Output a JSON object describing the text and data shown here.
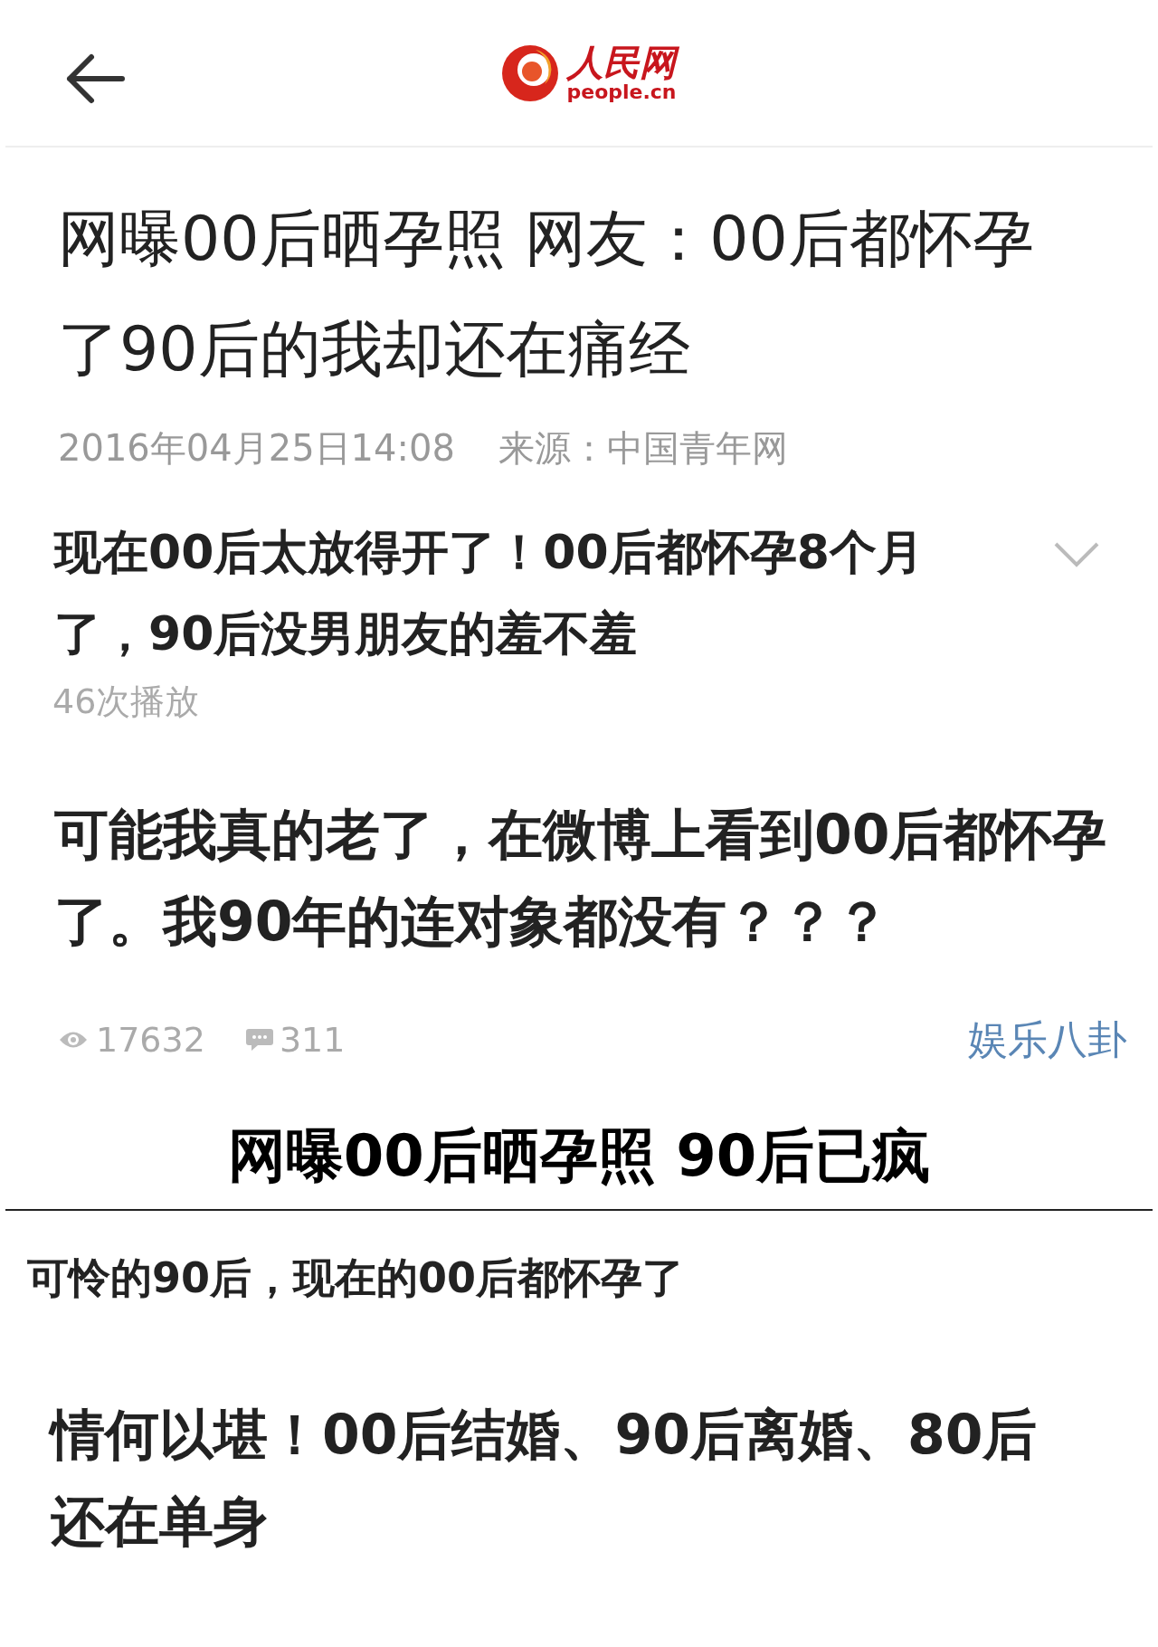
{
  "header": {
    "logo": {
      "name": "人民网",
      "domain": "people.cn"
    }
  },
  "article": {
    "title": "网曝00后晒孕照 网友：00后都怀孕了90后的我却还在痛经",
    "date": "2016年04月25日14:08",
    "source": "来源：中国青年网"
  },
  "video": {
    "title": "现在00后太放得开了！00后都怀孕8个月了，90后没男朋友的羞不羞",
    "plays": "46次播放",
    "expanded": false
  },
  "post": {
    "text": "可能我真的老了，在微博上看到00后都怀孕了。我90年的连对象都没有？？？",
    "views": "17632",
    "comments": "311",
    "category": "娱乐八卦"
  },
  "section_title": "网曝00后晒孕照 90后已疯",
  "feed": [
    {
      "kind": "subtitle",
      "text": "可怜的90后，现在的00后都怀孕了"
    },
    {
      "kind": "headline",
      "text": "情何以堪！00后结婚、90后离婚、80后还在单身"
    }
  ]
}
